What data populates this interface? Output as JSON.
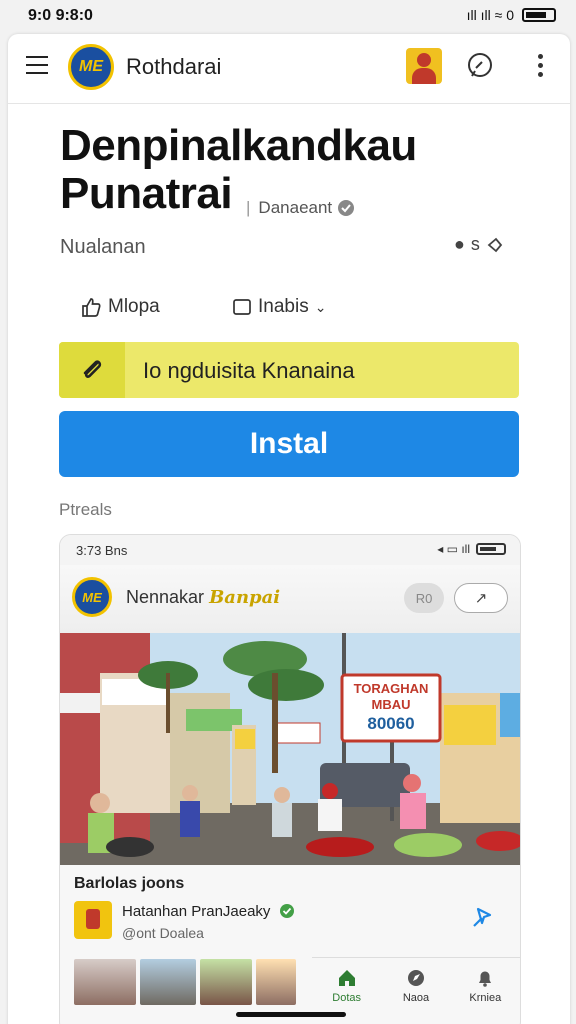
{
  "status_bar": {
    "time": "9:0 9:8:0",
    "icons": "ıll ıll ≈ 0"
  },
  "header": {
    "app_name": "Rothdarai",
    "logo_text": "ME"
  },
  "article": {
    "title": "Denpinalkandkau Punatrai",
    "badge": "Danaeant",
    "badge_separator": "|",
    "subtitle": "Nualanan",
    "share_text": "s"
  },
  "actions": {
    "like_label": "Mlopa",
    "tab_label": "Inabis"
  },
  "promo": {
    "text": "Io ngduisita Knanaina"
  },
  "install": {
    "label": "Instal"
  },
  "section": {
    "label": "Ptreals"
  },
  "preview": {
    "status_time": "3:73 Bns",
    "status_icons": "◂ ▭ ıll",
    "logo_text": "ME",
    "title_plain": "Nennakar",
    "title_script": "Banpai",
    "pill1": "R0",
    "pill2": "↗",
    "sign_line1": "TORAGHAN",
    "sign_line2": "MBAU",
    "sign_number": "80060",
    "caption": "Barlolas joons",
    "source_name": "Hatanhan PranJaeaky",
    "source_sub": "@ont Doalea",
    "nav": [
      {
        "label": "Dotas",
        "icon": "home-icon",
        "active": true
      },
      {
        "label": "Naoa",
        "icon": "explore-icon",
        "active": false
      },
      {
        "label": "Krniea",
        "icon": "notifications-icon",
        "active": false
      }
    ]
  },
  "colors": {
    "promo_bg": "#ece86a",
    "promo_icon_bg": "#dedb3c",
    "install_bg": "#1e88e5",
    "nav_active": "#2e7d32",
    "pin_accent": "#1e88e5"
  }
}
